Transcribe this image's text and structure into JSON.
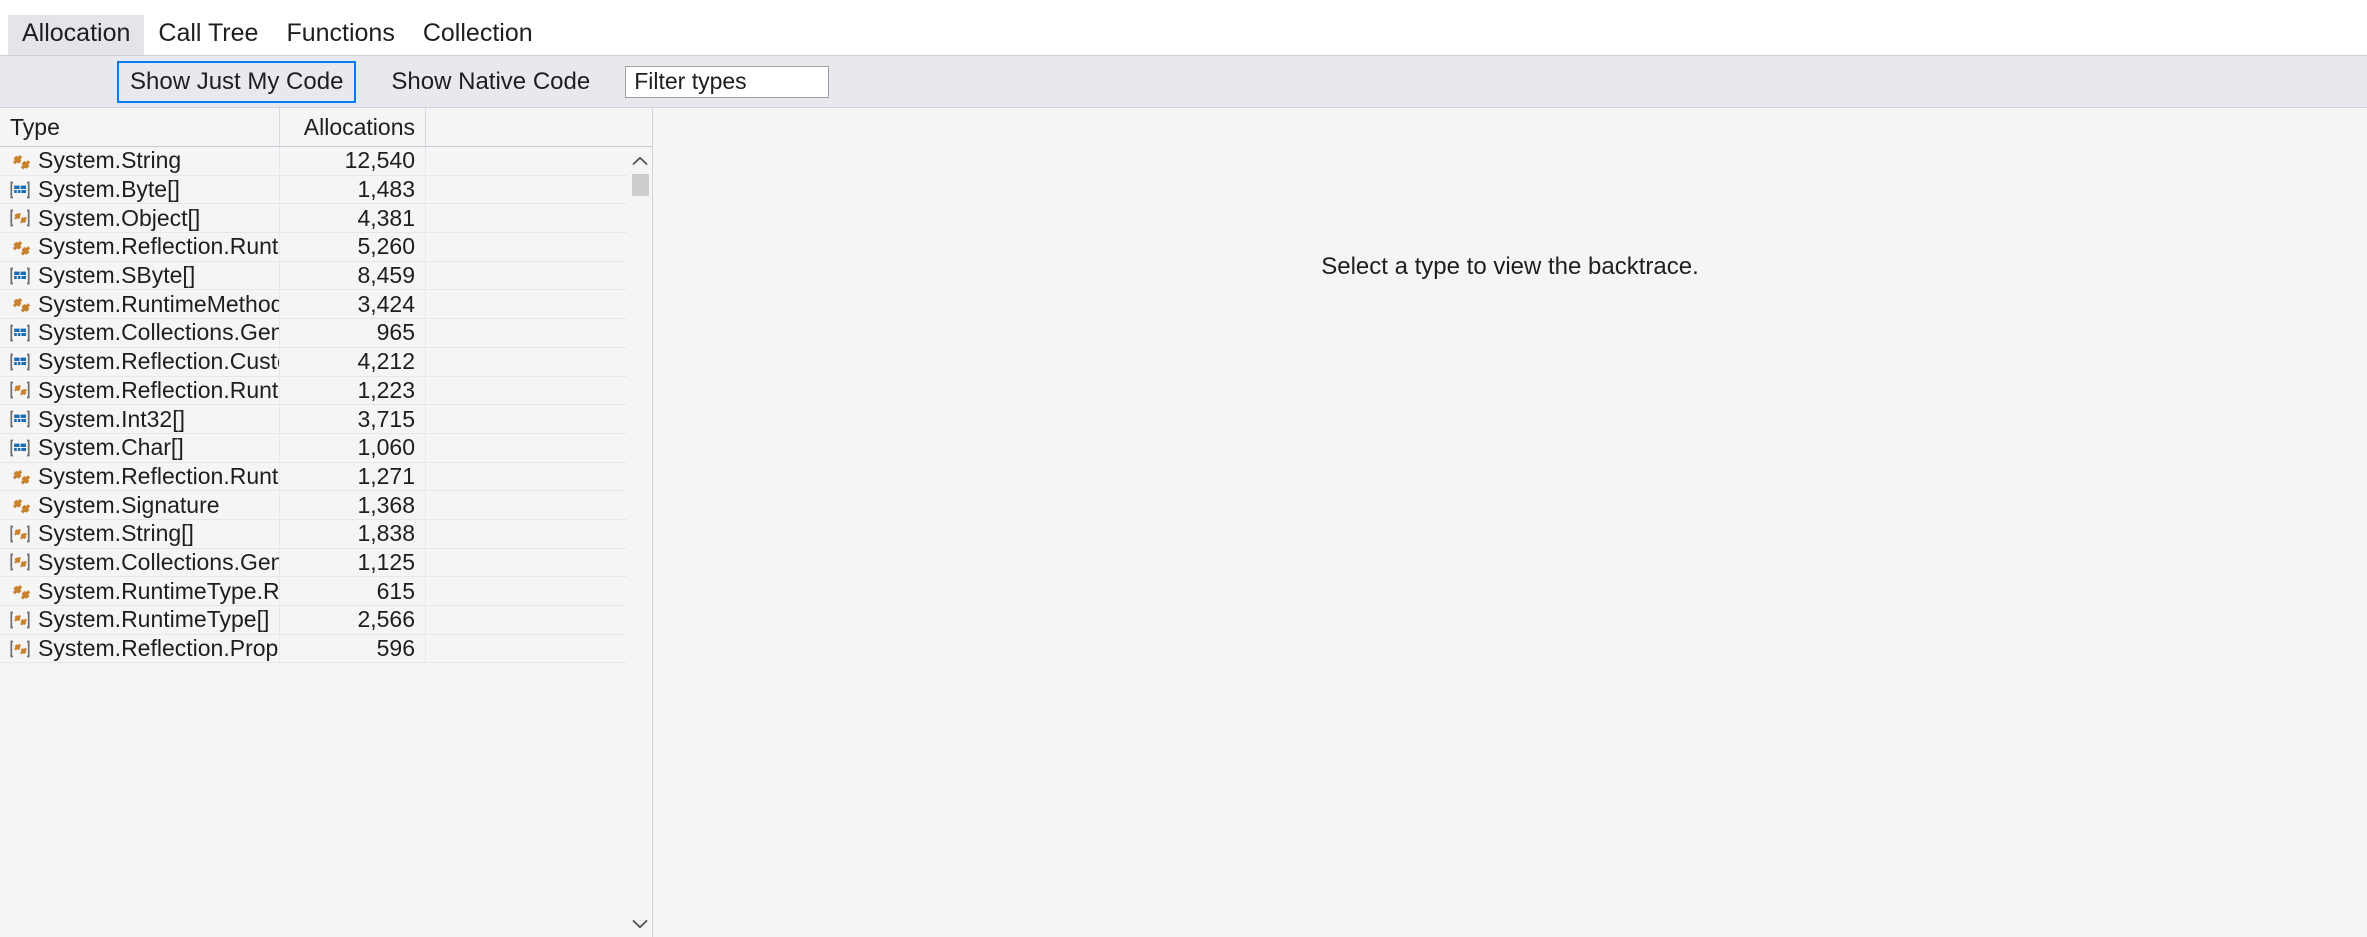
{
  "window": {
    "background": "#f5f5f5"
  },
  "tabs": {
    "items": [
      {
        "label": "Allocation",
        "selected": true
      },
      {
        "label": "Call Tree",
        "selected": false
      },
      {
        "label": "Functions",
        "selected": false
      },
      {
        "label": "Collection",
        "selected": false
      }
    ]
  },
  "toolbar": {
    "show_just_my_code_label": "Show Just My Code",
    "show_native_code_label": "Show Native Code",
    "filter_placeholder": "Filter types",
    "filter_value": "",
    "focus_border_color": "#0a7cf0"
  },
  "grid": {
    "columns": [
      {
        "key": "type",
        "label": "Type",
        "align": "left"
      },
      {
        "key": "allocations",
        "label": "Allocations",
        "align": "right"
      }
    ],
    "rows": [
      {
        "icon": "class-icon",
        "type": "System.String",
        "allocations": "12,540"
      },
      {
        "icon": "struct-array-icon",
        "type": "System.Byte[]",
        "allocations": "1,483"
      },
      {
        "icon": "class-array-icon",
        "type": "System.Object[]",
        "allocations": "4,381"
      },
      {
        "icon": "class-icon",
        "type": "System.Reflection.RuntimeMet...",
        "allocations": "5,260"
      },
      {
        "icon": "struct-array-icon",
        "type": "System.SByte[]",
        "allocations": "8,459"
      },
      {
        "icon": "class-icon",
        "type": "System.RuntimeMethodInfoStub",
        "allocations": "3,424"
      },
      {
        "icon": "struct-array-icon",
        "type": "System.Collections.Generic.Dicti...",
        "allocations": "965"
      },
      {
        "icon": "struct-array-icon",
        "type": "System.Reflection.CustomAttrib...",
        "allocations": "4,212"
      },
      {
        "icon": "class-array-icon",
        "type": "System.Reflection.RuntimeMet...",
        "allocations": "1,223"
      },
      {
        "icon": "struct-array-icon",
        "type": "System.Int32[]",
        "allocations": "3,715"
      },
      {
        "icon": "struct-array-icon",
        "type": "System.Char[]",
        "allocations": "1,060"
      },
      {
        "icon": "class-icon",
        "type": "System.Reflection.RuntimePara...",
        "allocations": "1,271"
      },
      {
        "icon": "class-icon",
        "type": "System.Signature",
        "allocations": "1,368"
      },
      {
        "icon": "class-array-icon",
        "type": "System.String[]",
        "allocations": "1,838"
      },
      {
        "icon": "class-array-icon",
        "type": "System.Collections.Generic.Sort...",
        "allocations": "1,125"
      },
      {
        "icon": "class-icon",
        "type": "System.RuntimeType.RuntimeT...",
        "allocations": "615"
      },
      {
        "icon": "class-array-icon",
        "type": "System.RuntimeType[]",
        "allocations": "2,566"
      },
      {
        "icon": "class-array-icon",
        "type": "System.Reflection.PropertyInfo[]",
        "allocations": "596"
      }
    ]
  },
  "scrollbar": {
    "up_arrow": "chevron-up",
    "down_arrow": "chevron-down",
    "thumb_color": "#cdcdcd"
  },
  "detail": {
    "empty_message": "Select a type to view the backtrace."
  },
  "icon_colors": {
    "class": "#c9822b",
    "struct": "#1a6cb5",
    "bracket": "#6d6d6d"
  }
}
